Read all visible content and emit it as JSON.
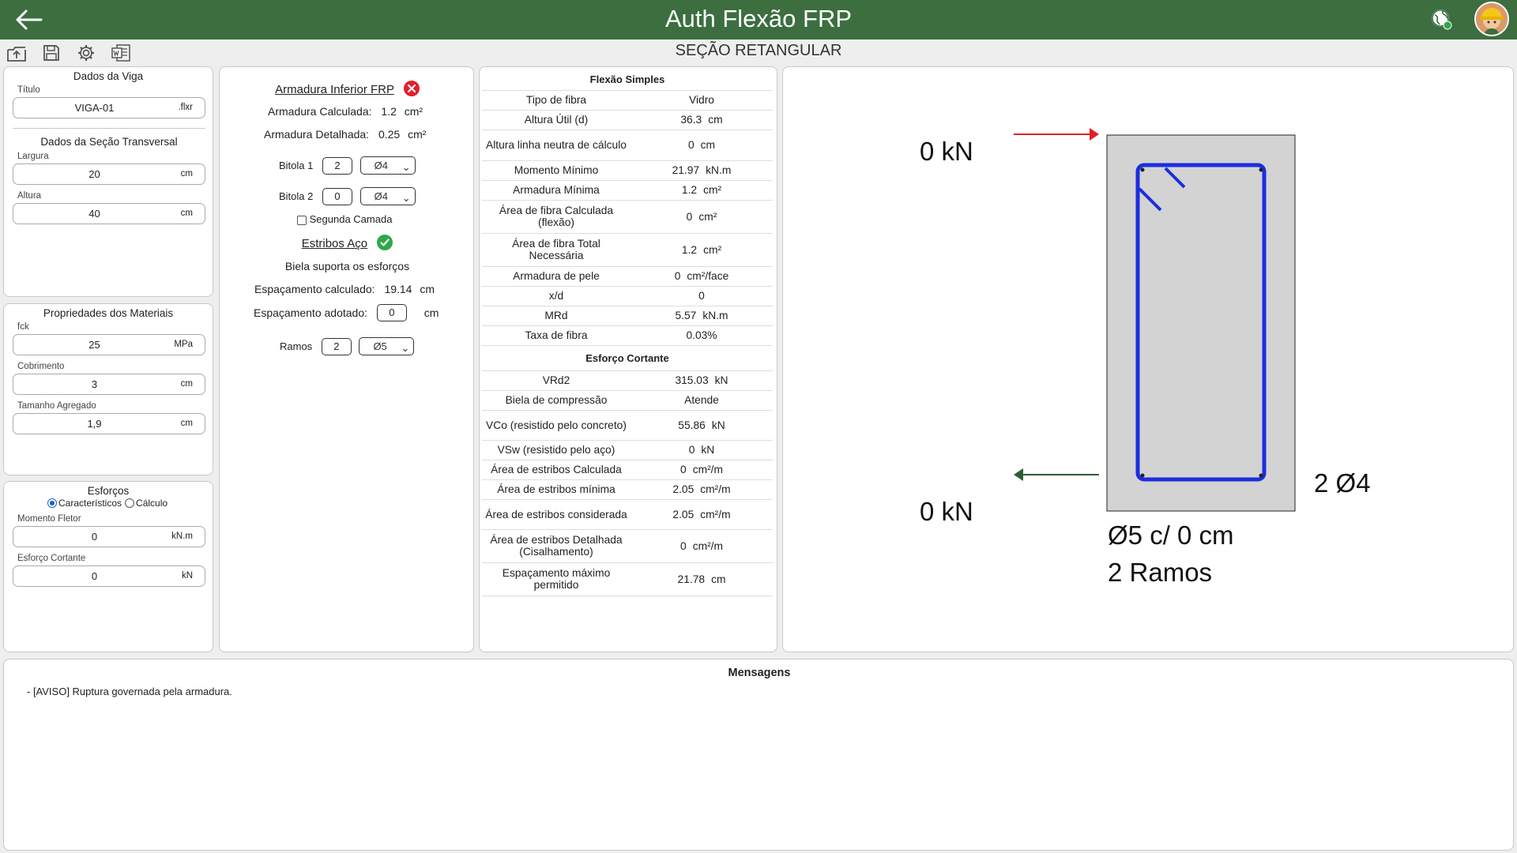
{
  "header": {
    "title": "Auth Flexão FRP",
    "section_title": "SEÇÃO RETANGULAR"
  },
  "toolbar": {
    "icons": [
      "upload-icon",
      "save-icon",
      "gear-icon",
      "word-export-icon"
    ]
  },
  "viga": {
    "title": "Dados da Viga",
    "titulo_label": "Título",
    "titulo_value": "VIGA-01",
    "titulo_suffix": ".flxr",
    "secao_title": "Dados da Seção Transversal",
    "largura_label": "Largura",
    "largura_value": "20",
    "largura_unit": "cm",
    "altura_label": "Altura",
    "altura_value": "40",
    "altura_unit": "cm"
  },
  "materiais": {
    "title": "Propriedades dos Materiais",
    "fck_label": "fck",
    "fck_value": "25",
    "fck_unit": "MPa",
    "cobrimento_label": "Cobrimento",
    "cobrimento_value": "3",
    "cobrimento_unit": "cm",
    "agregado_label": "Tamanho Agregado",
    "agregado_value": "1,9",
    "agregado_unit": "cm"
  },
  "esforcos": {
    "title": "Esforços",
    "radio_caracteristicos": "Característicos",
    "radio_calculo": "Cálculo",
    "momento_label": "Momento Fletor",
    "momento_value": "0",
    "momento_unit": "kN.m",
    "cortante_label": "Esforço Cortante",
    "cortante_value": "0",
    "cortante_unit": "kN"
  },
  "armadura": {
    "title": "Armadura Inferior FRP",
    "calculada_label": "Armadura Calculada:",
    "calculada_value": "1.2",
    "calculada_unit": "cm²",
    "detalhada_label": "Armadura Detalhada:",
    "detalhada_value": "0.25",
    "detalhada_unit": "cm²",
    "bitola1_label": "Bitola 1",
    "bitola1_qty": "2",
    "bitola1_diam": "Ø4",
    "bitola2_label": "Bitola 2",
    "bitola2_qty": "0",
    "bitola2_diam": "Ø4",
    "segunda_camada": "Segunda Camada",
    "status_color": "#e0202a"
  },
  "estribos": {
    "title": "Estribos Aço",
    "biela_text": "Biela suporta os esforços",
    "esp_calc_label": "Espaçamento calculado:",
    "esp_calc_value": "19.14",
    "esp_calc_unit": "cm",
    "esp_adot_label": "Espaçamento adotado:",
    "esp_adot_value": "0",
    "esp_adot_unit": "cm",
    "ramos_label": "Ramos",
    "ramos_value": "2",
    "ramos_diam": "Ø5",
    "status_color": "#2ea84a"
  },
  "flexao": {
    "title": "Flexão Simples",
    "rows": [
      {
        "label": "Tipo de fibra",
        "value": "Vidro",
        "unit": ""
      },
      {
        "label": "Altura Útil (d)",
        "value": "36.3",
        "unit": "cm"
      },
      {
        "label": "Altura linha neutra de cálculo",
        "value": "0",
        "unit": "cm"
      },
      {
        "label": "Momento Mínimo",
        "value": "21.97",
        "unit": "kN.m"
      },
      {
        "label": "Armadura Mínima",
        "value": "1.2",
        "unit": "cm²"
      },
      {
        "label": "Área de fibra Calculada (flexão)",
        "value": "0",
        "unit": "cm²"
      },
      {
        "label": "Área de fibra Total Necessária",
        "value": "1.2",
        "unit": "cm²"
      },
      {
        "label": "Armadura de pele",
        "value": "0",
        "unit": "cm²/face"
      },
      {
        "label": "x/d",
        "value": "0",
        "unit": ""
      },
      {
        "label": "MRd",
        "value": "5.57",
        "unit": "kN.m"
      },
      {
        "label": "Taxa de fibra",
        "value": "0.03%",
        "unit": ""
      }
    ]
  },
  "cortante": {
    "title": "Esforço Cortante",
    "rows": [
      {
        "label": "VRd2",
        "value": "315.03",
        "unit": "kN"
      },
      {
        "label": "Biela de compressão",
        "value": "Atende",
        "unit": ""
      },
      {
        "label": "VCo (resistido pelo concreto)",
        "value": "55.86",
        "unit": "kN"
      },
      {
        "label": "VSw (resistido pelo aço)",
        "value": "0",
        "unit": "kN"
      },
      {
        "label": "Área de estribos Calculada",
        "value": "0",
        "unit": "cm²/m"
      },
      {
        "label": "Área de estribos mínima",
        "value": "2.05",
        "unit": "cm²/m"
      },
      {
        "label": "Área de estribos considerada",
        "value": "2.05",
        "unit": "cm²/m"
      },
      {
        "label": "Área de estribos Detalhada (Cisalhamento)",
        "value": "0",
        "unit": "cm²/m"
      },
      {
        "label": "Espaçamento máximo permitido",
        "value": "21.78",
        "unit": "cm"
      }
    ]
  },
  "drawing": {
    "top_force": "0 kN",
    "bottom_force": "0 kN",
    "bottom_bars": "2 Ø4",
    "stirrup_line1": "Ø5 c/ 0 cm",
    "stirrup_line2": "2 Ramos",
    "top_arrow_color": "#e0202a",
    "bottom_arrow_color": "#2e5e33",
    "rebar_color": "#1a2ee0",
    "section_fill": "#d3d3d3"
  },
  "mensagens": {
    "title": "Mensagens",
    "items": [
      "- [AVISO] Ruptura governada pela armadura."
    ]
  }
}
